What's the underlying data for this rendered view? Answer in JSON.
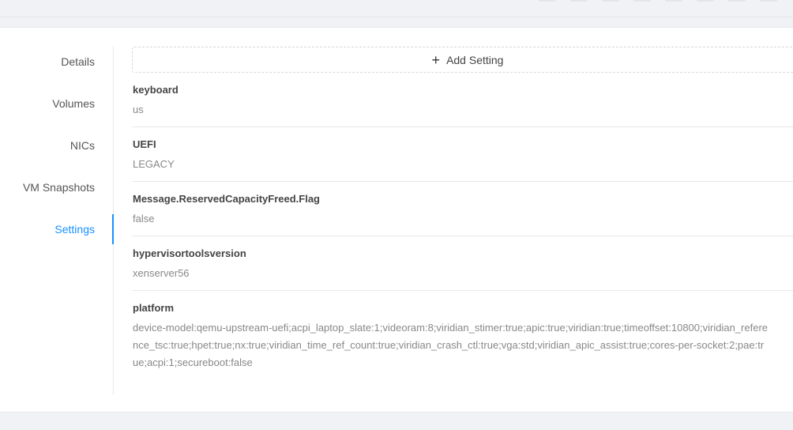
{
  "sidebar": {
    "items": [
      {
        "label": "Details",
        "active": false
      },
      {
        "label": "Volumes",
        "active": false
      },
      {
        "label": "NICs",
        "active": false
      },
      {
        "label": "VM Snapshots",
        "active": false
      },
      {
        "label": "Settings",
        "active": true
      }
    ],
    "accent_color": "#1890ff"
  },
  "settings": {
    "add_button_label": "Add Setting",
    "add_button_icon": "plus-icon",
    "items": [
      {
        "key": "keyboard",
        "value": "us"
      },
      {
        "key": "UEFI",
        "value": "LEGACY"
      },
      {
        "key": "Message.ReservedCapacityFreed.Flag",
        "value": "false"
      },
      {
        "key": "hypervisortoolsversion",
        "value": "xenserver56"
      },
      {
        "key": "platform",
        "value": "device-model:qemu-upstream-uefi;acpi_laptop_slate:1;videoram:8;viridian_stimer:true;apic:true;viridian:true;timeoffset:10800;viridian_reference_tsc:true;hpet:true;nx:true;viridian_time_ref_count:true;viridian_crash_ctl:true;vga:std;viridian_apic_assist:true;cores-per-socket:2;pae:true;acpi:1;secureboot:false"
      }
    ]
  }
}
